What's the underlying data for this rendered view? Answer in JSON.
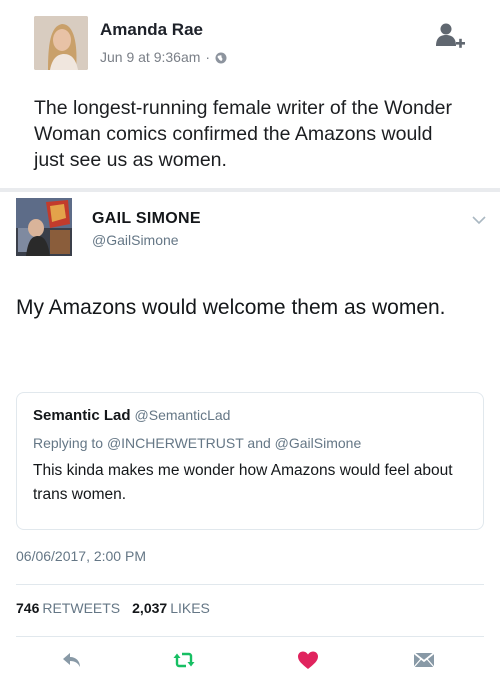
{
  "facebook_post": {
    "author_name": "Amanda Rae",
    "timestamp": "Jun 9 at 9:36am",
    "separator": "·",
    "privacy_icon": "globe-icon",
    "add_friend_icon": "add-friend-icon",
    "body": "The longest-running female writer of the Wonder Woman comics confirmed the Amazons would just see us as women."
  },
  "tweet": {
    "author_name": "GAIL SIMONE",
    "handle": "@GailSimone",
    "body": "My Amazons would welcome them as women.",
    "timestamp": "06/06/2017, 2:00 PM",
    "quoted": {
      "author_name": "Semantic Lad",
      "handle": "@SemanticLad",
      "reply_prefix": "Replying to",
      "reply_user_1": "@INCHERWETRUST",
      "reply_and": "and",
      "reply_user_2": "@GailSimone",
      "body": "This kinda makes me wonder how Amazons would feel about trans women."
    },
    "stats": {
      "retweets_count": "746",
      "retweets_label": "RETWEETS",
      "likes_count": "2,037",
      "likes_label": "LIKES"
    },
    "actions": [
      "reply-icon",
      "retweet-icon",
      "like-icon",
      "direct-message-icon"
    ]
  },
  "colors": {
    "retweet_green": "#17bf63",
    "like_red": "#e0245e",
    "muted_gray": "#657786"
  }
}
